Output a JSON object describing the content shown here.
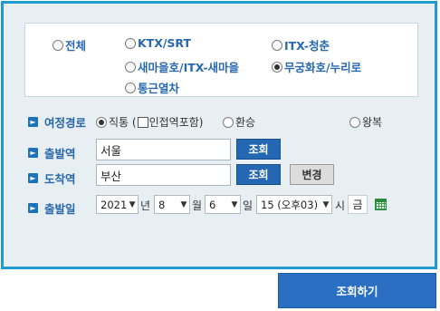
{
  "train_types": [
    {
      "label": "전체",
      "checked": false
    },
    {
      "label": "KTX/SRT",
      "checked": false
    },
    {
      "label": "ITX-청춘",
      "checked": false
    },
    {
      "label": "새마을호/ITX-새마을",
      "checked": false
    },
    {
      "label": "무궁화호/누리로",
      "checked": true
    },
    {
      "label": "통근열차",
      "checked": false
    }
  ],
  "route": {
    "label": "여정경로",
    "direct": "직통 (",
    "transfer_station_label": "인접역포함)",
    "transfer": "환승",
    "round_trip": "왕복"
  },
  "departure": {
    "label": "출발역",
    "value": "서울",
    "search_button": "조회"
  },
  "arrival": {
    "label": "도착역",
    "value": "부산",
    "search_button": "조회",
    "swap_button": "변경"
  },
  "date": {
    "label": "출발일",
    "year": "2021",
    "year_unit": "년",
    "month": "8",
    "month_unit": "월",
    "day": "6",
    "day_unit": "일",
    "hour": "15 (오후03)",
    "hour_unit": "시",
    "weekday": "금"
  },
  "search_button": "조회하기"
}
